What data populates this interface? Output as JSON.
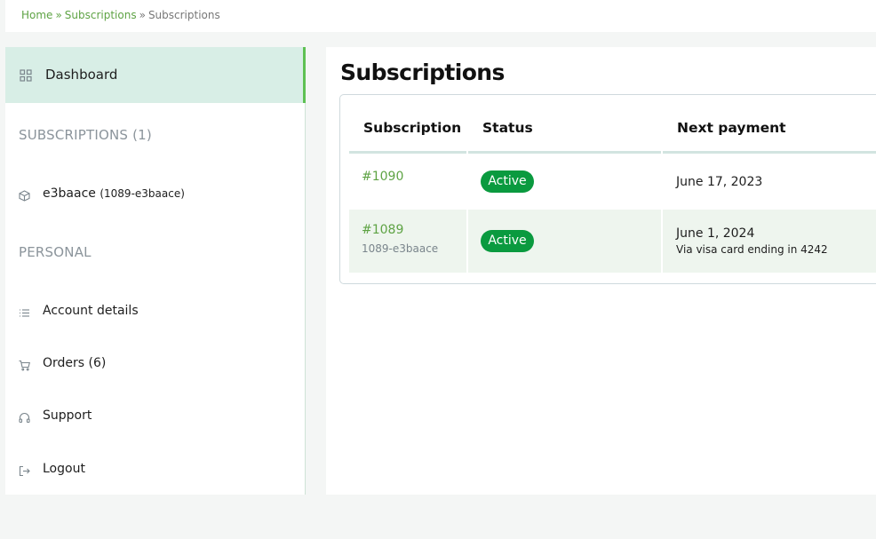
{
  "breadcrumb": {
    "home": "Home",
    "separator": "»",
    "subscriptions": "Subscriptions",
    "current": "Subscriptions"
  },
  "sidebar": {
    "dashboard": {
      "label": "Dashboard",
      "icon": "grid-icon"
    },
    "subscriptions_heading": "SUBSCRIPTIONS (1)",
    "subscription_item": {
      "label": "e3baace",
      "ref": "(1089-e3baace)",
      "icon": "box-icon"
    },
    "personal_heading": "PERSONAL",
    "items": [
      {
        "label": "Account details",
        "icon": "list-icon"
      },
      {
        "label": "Orders (6)",
        "icon": "cart-icon"
      },
      {
        "label": "Support",
        "icon": "headphones-icon"
      },
      {
        "label": "Logout",
        "icon": "logout-icon"
      }
    ]
  },
  "main": {
    "title": "Subscriptions",
    "table": {
      "headers": [
        "Subscription",
        "Status",
        "Next payment"
      ],
      "rows": [
        {
          "id": "#1090",
          "ref": "",
          "status": "Active",
          "next_payment": "June 17, 2023",
          "payment_method": ""
        },
        {
          "id": "#1089",
          "ref": "1089-e3baace",
          "status": "Active",
          "next_payment": "June 1, 2024",
          "payment_method": "Via visa card ending in 4242"
        }
      ]
    }
  },
  "colors": {
    "accent": "#5ea344",
    "active_badge": "#0a9a3f",
    "sidebar_active_bg": "#d8eee6"
  }
}
